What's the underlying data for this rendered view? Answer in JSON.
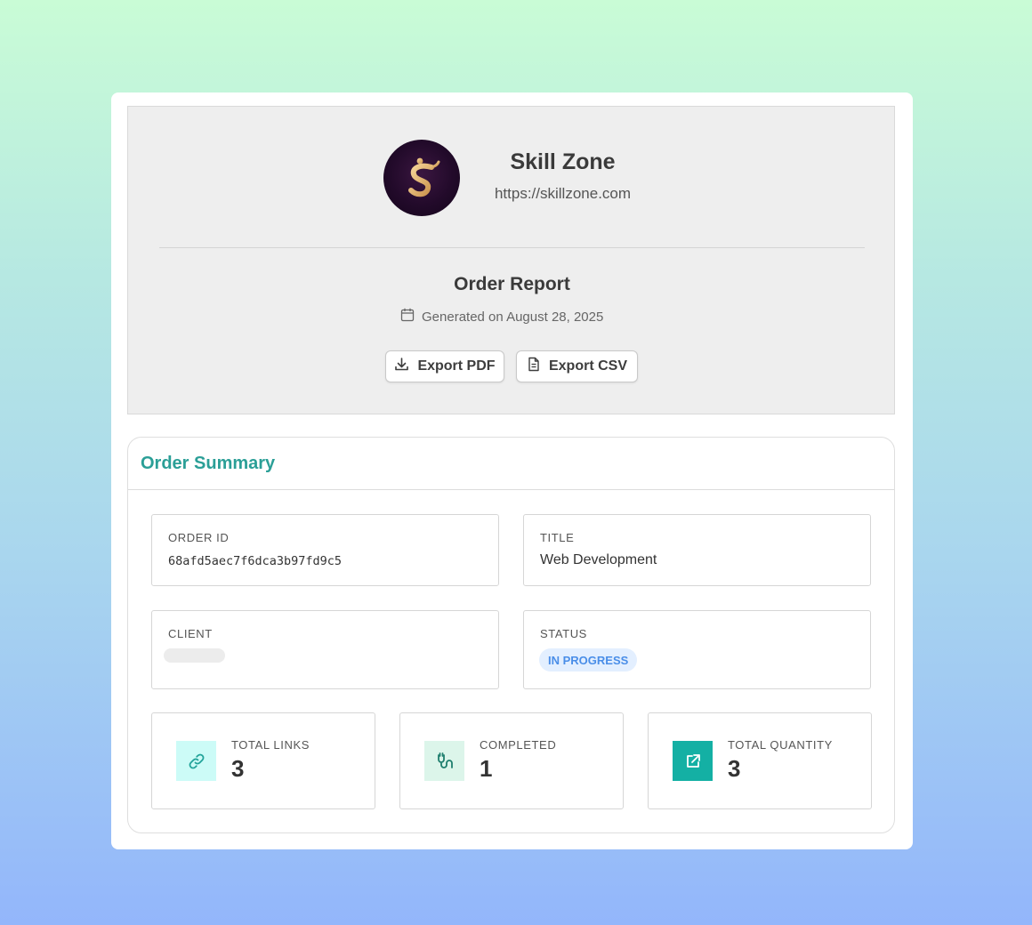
{
  "brand": {
    "name": "Skill Zone",
    "url": "https://skillzone.com"
  },
  "report": {
    "title": "Order Report",
    "generated": "Generated on August 28, 2025"
  },
  "actions": {
    "export_pdf": "Export PDF",
    "export_csv": "Export CSV"
  },
  "summary": {
    "title": "Order Summary",
    "fields": {
      "order_id": {
        "label": "ORDER ID",
        "value": "68afd5aec7f6dca3b97fd9c5"
      },
      "title": {
        "label": "TITLE",
        "value": "Web Development"
      },
      "client": {
        "label": "CLIENT",
        "value": ""
      },
      "status": {
        "label": "STATUS",
        "value": "IN PROGRESS"
      }
    },
    "stats": [
      {
        "label": "TOTAL LINKS",
        "value": "3",
        "icon": "link-icon"
      },
      {
        "label": "COMPLETED",
        "value": "1",
        "icon": "plug-icon"
      },
      {
        "label": "TOTAL QUANTITY",
        "value": "3",
        "icon": "external-link-icon"
      }
    ]
  },
  "colors": {
    "accent": "#2b9f97",
    "status_badge_bg": "#e3efff",
    "status_badge_text": "#4a8ee8",
    "stat1_icon_bg": "#ccfbf7",
    "stat2_icon_bg": "#dcf5ea",
    "stat3_icon_bg": "#14b0a4"
  }
}
